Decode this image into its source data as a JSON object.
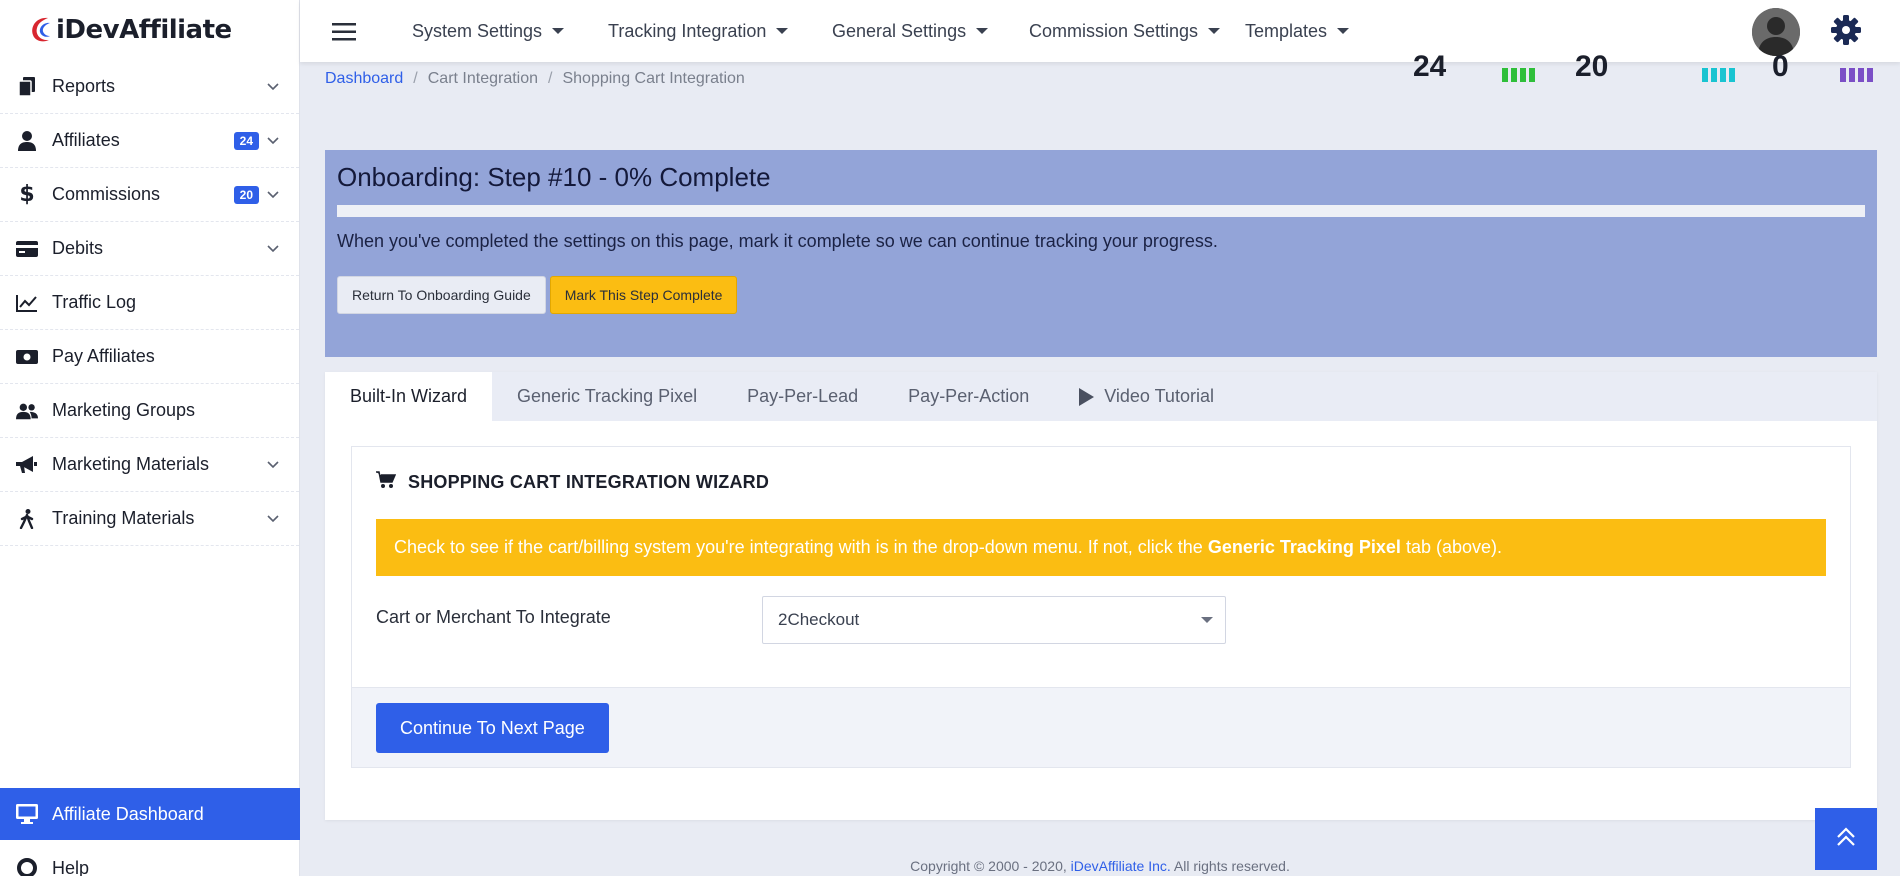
{
  "brand": {
    "logo_text": "iDevAffiliate",
    "accent": "#2f5fe8",
    "warning": "#fbbd12"
  },
  "sidebar": {
    "items": [
      {
        "label": "Reports",
        "icon": "file-icon",
        "has_chevron": true
      },
      {
        "label": "Affiliates",
        "icon": "user-icon",
        "badge": "24",
        "has_chevron": true
      },
      {
        "label": "Commissions",
        "icon": "dollar-icon",
        "badge": "20",
        "has_chevron": true
      },
      {
        "label": "Debits",
        "icon": "credit-card-icon",
        "has_chevron": true
      },
      {
        "label": "Traffic Log",
        "icon": "chart-line-icon"
      },
      {
        "label": "Pay Affiliates",
        "icon": "money-icon"
      },
      {
        "label": "Marketing Groups",
        "icon": "users-icon"
      },
      {
        "label": "Marketing Materials",
        "icon": "bullhorn-icon",
        "has_chevron": true
      },
      {
        "label": "Training Materials",
        "icon": "walking-icon",
        "has_chevron": true
      }
    ],
    "active_item": {
      "label": "Affiliate Dashboard",
      "icon": "desktop-icon"
    },
    "help_item": {
      "label": "Help",
      "icon": "life-ring-icon"
    }
  },
  "topnav": {
    "menus": [
      "System Settings",
      "Tracking Integration",
      "General Settings",
      "Commission Settings",
      "Templates"
    ]
  },
  "stats": {
    "values": [
      "24",
      "20",
      "0"
    ],
    "bar_colors": [
      "#2fbf3a",
      "#19c4d1",
      "#7b4fc6"
    ]
  },
  "breadcrumb": {
    "items": [
      "Dashboard",
      "Cart Integration",
      "Shopping Cart Integration"
    ]
  },
  "onboarding": {
    "title": "Onboarding: Step #10 - 0% Complete",
    "progress_percent": 0,
    "description": "When you've completed the settings on this page, mark it complete so we can continue tracking your progress.",
    "return_button": "Return To Onboarding Guide",
    "complete_button": "Mark This Step Complete"
  },
  "tabs": [
    "Built-In Wizard",
    "Generic Tracking Pixel",
    "Pay-Per-Lead",
    "Pay-Per-Action",
    "Video Tutorial"
  ],
  "wizard": {
    "title": "SHOPPING CART INTEGRATION WIZARD",
    "alert_before": "Check to see if the cart/billing system you're integrating with is in the drop-down menu. If not, click the",
    "alert_bold": "Generic Tracking Pixel",
    "alert_after": "tab (above).",
    "field_label": "Cart or Merchant To Integrate",
    "selected_value": "2Checkout",
    "continue_button": "Continue To Next Page"
  },
  "footer": {
    "before": "Copyright © 2000 - 2020,",
    "link": "iDevAffiliate Inc.",
    "after": "All rights reserved."
  }
}
